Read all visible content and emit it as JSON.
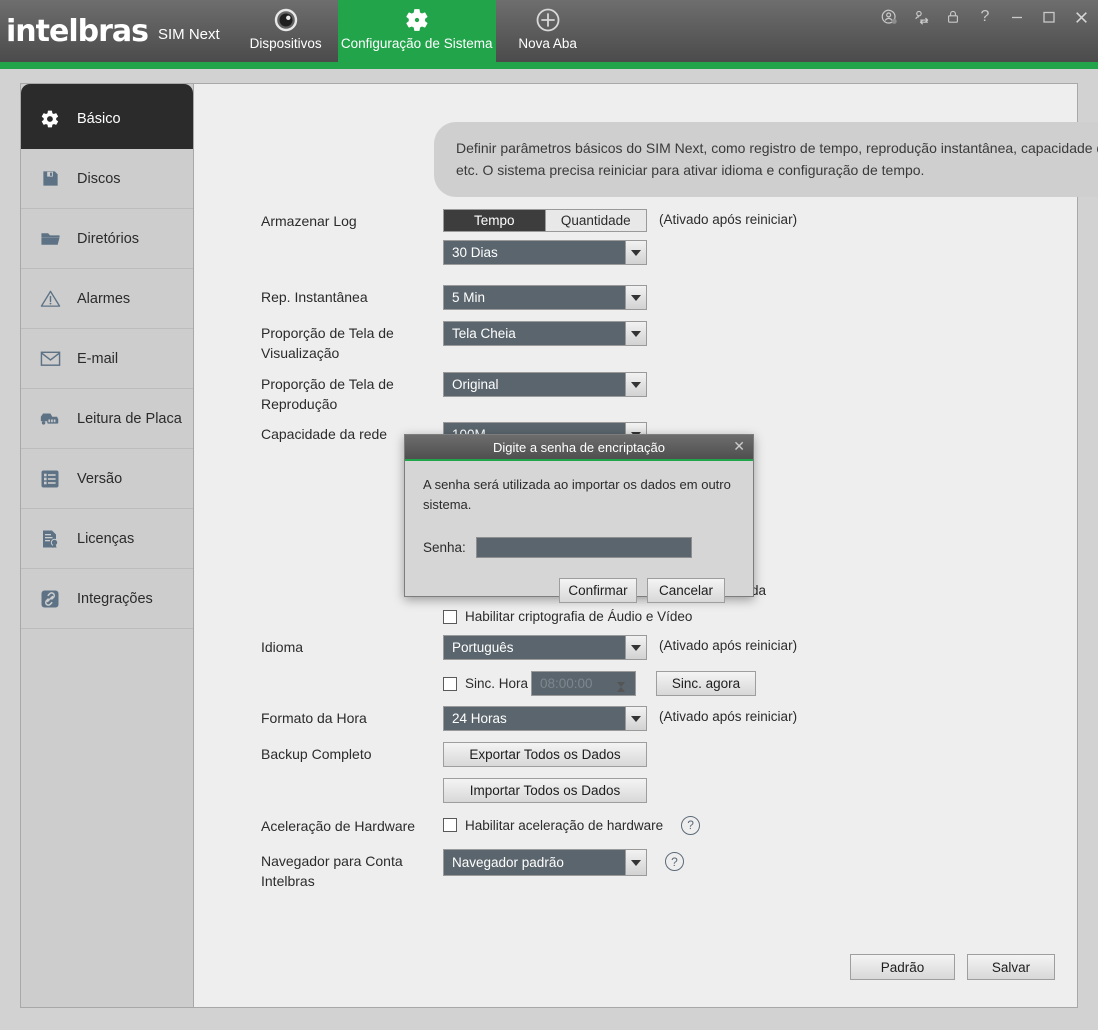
{
  "app": {
    "brand": "intelbras",
    "product": "SIM Next",
    "tabs": [
      {
        "label": "Dispositivos",
        "icon": "camera-icon",
        "active": false
      },
      {
        "label": "Configuração de Sistema",
        "icon": "gear-icon",
        "active": true
      },
      {
        "label": "Nova Aba",
        "icon": "plus-circle-icon",
        "active": false
      }
    ],
    "window_controls": [
      {
        "name": "account-icon",
        "glyph": "ⓘ"
      },
      {
        "name": "switch-user-icon",
        "glyph": "⇄"
      },
      {
        "name": "lock-icon",
        "glyph": "⚿"
      },
      {
        "name": "help-icon",
        "glyph": "?"
      },
      {
        "name": "minimize-button",
        "glyph": "─"
      },
      {
        "name": "maximize-button",
        "glyph": "□"
      },
      {
        "name": "close-button",
        "glyph": "✕"
      }
    ],
    "accent_color": "#22a44b"
  },
  "sidebar": {
    "items": [
      {
        "label": "Básico",
        "icon": "gear-icon",
        "active": true
      },
      {
        "label": "Discos",
        "icon": "floppy-disk-icon",
        "active": false
      },
      {
        "label": "Diretórios",
        "icon": "folder-icon",
        "active": false
      },
      {
        "label": "Alarmes",
        "icon": "warning-triangle-icon",
        "active": false
      },
      {
        "label": "E-mail",
        "icon": "envelope-icon",
        "active": false
      },
      {
        "label": "Leitura de Placa",
        "icon": "license-plate-icon",
        "active": false
      },
      {
        "label": "Versão",
        "icon": "list-icon",
        "active": false
      },
      {
        "label": "Licenças",
        "icon": "certificate-icon",
        "active": false
      },
      {
        "label": "Integrações",
        "icon": "link-icon",
        "active": false
      }
    ]
  },
  "main": {
    "banner": "Definir parâmetros básicos do SIM Next, como registro de tempo, reprodução instantânea, capacidade de rede e etc. O sistema precisa reiniciar para ativar idioma e configuração de tempo.",
    "restart_hint": "(Ativado após reiniciar)",
    "fields": {
      "store_log": {
        "label": "Armazenar Log",
        "toggle_active": "Tempo",
        "toggle_inactive": "Quantidade",
        "value": "30 Dias"
      },
      "instant_replay": {
        "label": "Rep. Instantânea",
        "value": "5 Min"
      },
      "view_ratio": {
        "label": "Proporção de Tela de Visualização",
        "value": "Tela Cheia"
      },
      "playback_ratio": {
        "label": "Proporção de Tela de Reprodução",
        "value": "Original"
      },
      "network_capacity": {
        "label": "Capacidade da rede",
        "value": "100M"
      },
      "partial_behind_modal": "da",
      "av_encryption": {
        "label": "Habilitar criptografia de Áudio e Vídeo",
        "checked": false
      },
      "language": {
        "label": "Idioma",
        "value": "Português"
      },
      "sync_time": {
        "label": "Sinc. Hora",
        "checked": false,
        "time_value": "08:00:00",
        "button": "Sinc. agora"
      },
      "hour_format": {
        "label": "Formato da Hora",
        "value": "24 Horas"
      },
      "full_backup": {
        "label": "Backup Completo",
        "export_button": "Exportar Todos os Dados",
        "import_button": "Importar Todos os Dados"
      },
      "hw_accel": {
        "label": "Aceleração de Hardware",
        "checkbox_label": "Habilitar aceleração de hardware",
        "checked": false
      },
      "browser_account": {
        "label": "Navegador para Conta Intelbras",
        "value": "Navegador padrão"
      }
    },
    "footer": {
      "default_button": "Padrão",
      "save_button": "Salvar"
    }
  },
  "modal": {
    "title": "Digite a senha de encriptação",
    "message": "A senha será utilizada ao importar os dados em outro sistema.",
    "password_label": "Senha:",
    "password_value": "",
    "confirm_button": "Confirmar",
    "cancel_button": "Cancelar"
  }
}
